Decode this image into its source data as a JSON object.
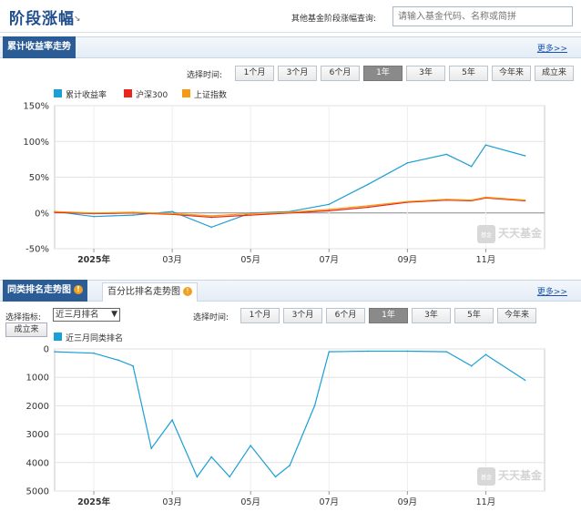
{
  "header": {
    "title": "阶段涨幅",
    "search_label": "其他基金阶段涨幅查询:",
    "search_placeholder": "请输入基金代码、名称或简拼"
  },
  "section1": {
    "tab": "累计收益率走势",
    "more": "更多>>",
    "select_time_label": "选择时间:",
    "range_buttons": [
      "1个月",
      "3个月",
      "6个月",
      "1年",
      "3年",
      "5年",
      "今年来",
      "成立来"
    ],
    "active_range": "1年",
    "legend": [
      {
        "label": "累计收益率",
        "color": "#1a9fd6"
      },
      {
        "label": "沪深300",
        "color": "#e8261c"
      },
      {
        "label": "上证指数",
        "color": "#f59a12"
      }
    ]
  },
  "section2": {
    "tab_active": "同类排名走势图",
    "tab_inactive": "百分比排名走势图",
    "more": "更多>>",
    "select_indicator_label": "选择指标:",
    "indicator_value": "近三月排名",
    "setup_button": "成立来",
    "select_time_label": "选择时间:",
    "range_buttons": [
      "1个月",
      "3个月",
      "6个月",
      "1年",
      "3年",
      "5年",
      "今年来"
    ],
    "active_range": "1年",
    "legend": [
      {
        "label": "近三月同类排名",
        "color": "#1a9fd6"
      }
    ]
  },
  "watermark": {
    "text": "天天基金",
    "sub": "基金"
  },
  "chart_data": [
    {
      "type": "line",
      "title": "",
      "x_tick_labels": [
        "2025年",
        "03月",
        "05月",
        "07月",
        "09月",
        "11月"
      ],
      "y_tick_labels": [
        "150%",
        "100%",
        "50%",
        "0%",
        "-50%"
      ],
      "ylim": [
        -50,
        150
      ],
      "x_range_months": [
        "2024-12",
        "2025-12"
      ],
      "x": [
        "2024-12",
        "2025-01",
        "2025-02",
        "2025-03",
        "2025-04",
        "2025-05",
        "2025-06",
        "2025-07",
        "2025-08",
        "2025-09",
        "2025-10",
        "2025-10-20",
        "2025-11",
        "2025-12"
      ],
      "series": [
        {
          "name": "累计收益率",
          "color": "#1a9fd6",
          "values": [
            2,
            -5,
            -3,
            2,
            -20,
            0,
            2,
            12,
            40,
            70,
            82,
            65,
            95,
            80
          ]
        },
        {
          "name": "沪深300",
          "color": "#e8261c",
          "values": [
            1,
            -1,
            0,
            -2,
            -6,
            -3,
            0,
            3,
            8,
            15,
            18,
            17,
            21,
            17
          ]
        },
        {
          "name": "上证指数",
          "color": "#f59a12",
          "values": [
            2,
            0,
            1,
            -1,
            -4,
            -1,
            1,
            5,
            10,
            16,
            19,
            18,
            22,
            18
          ]
        }
      ],
      "grid": true,
      "legend": "top-left"
    },
    {
      "type": "line",
      "title": "",
      "x_tick_labels": [
        "2025年",
        "03月",
        "05月",
        "07月",
        "09月",
        "11月"
      ],
      "y_tick_labels": [
        "0",
        "1000",
        "2000",
        "3000",
        "4000",
        "5000"
      ],
      "ylim": [
        5000,
        0
      ],
      "inverted_y": true,
      "x_range_months": [
        "2024-12",
        "2025-12"
      ],
      "x": [
        "2024-12",
        "2025-01",
        "2025-01-20",
        "2025-02",
        "2025-02-15",
        "2025-03",
        "2025-03-20",
        "2025-04",
        "2025-04-15",
        "2025-05",
        "2025-05-20",
        "2025-06",
        "2025-06-20",
        "2025-07",
        "2025-08",
        "2025-09",
        "2025-10",
        "2025-10-20",
        "2025-11",
        "2025-12"
      ],
      "series": [
        {
          "name": "近三月同类排名",
          "color": "#1a9fd6",
          "values": [
            100,
            150,
            400,
            600,
            3500,
            2500,
            4500,
            3800,
            4500,
            3400,
            4500,
            4100,
            2000,
            100,
            80,
            80,
            100,
            600,
            200,
            1100
          ]
        }
      ],
      "grid": true,
      "legend": "top-left"
    }
  ]
}
